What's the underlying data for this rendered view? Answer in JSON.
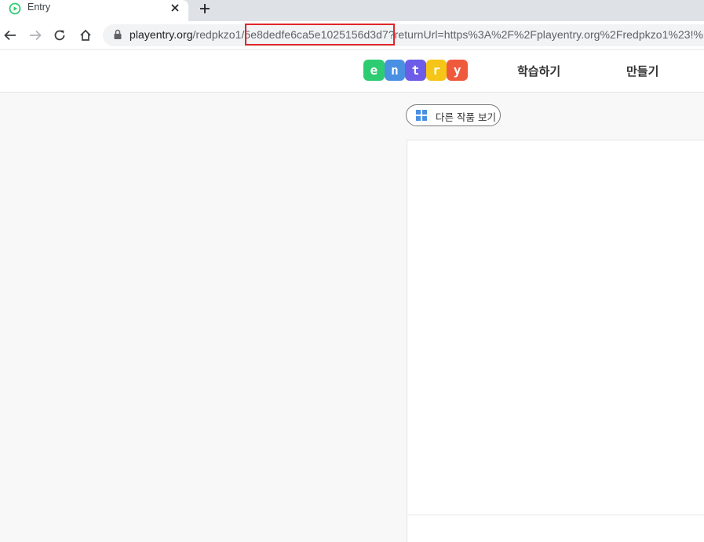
{
  "browser": {
    "tab_title": "Entry",
    "url_host": "playentry.org",
    "url_path_prefix": "/redpkzo1/",
    "url_highlighted": "5e8dedfe6ca5e1025156d3d7",
    "url_rest": "?returnUrl=https%3A%2F%2Fplayentry.org%2Fredpkzo1%23!%"
  },
  "site": {
    "logo_letters": [
      "e",
      "n",
      "t",
      "r",
      "y"
    ],
    "logo_colors": [
      "#2ecc71",
      "#4a90e2",
      "#6c5ce7",
      "#f5c518",
      "#f05a3c"
    ],
    "nav": [
      "학습하기",
      "만들기"
    ],
    "other_works_label": "다른 작품 보기"
  },
  "colors": {
    "highlight": "#e0252b",
    "brand_green": "#2ecc71"
  }
}
